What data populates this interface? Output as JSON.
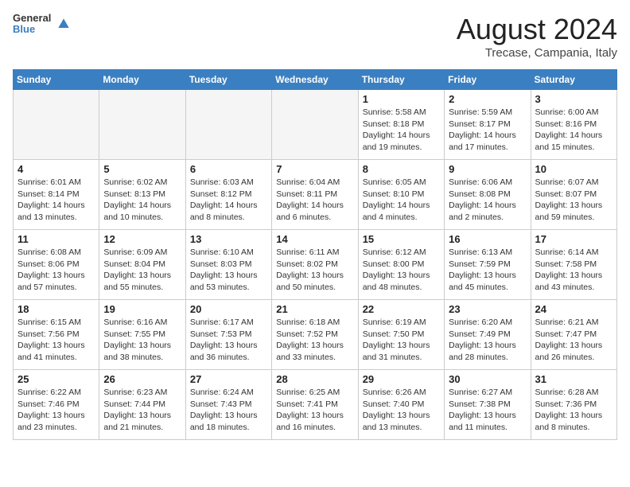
{
  "header": {
    "logo_line1": "General",
    "logo_line2": "Blue",
    "month_title": "August 2024",
    "location": "Trecase, Campania, Italy"
  },
  "days_of_week": [
    "Sunday",
    "Monday",
    "Tuesday",
    "Wednesday",
    "Thursday",
    "Friday",
    "Saturday"
  ],
  "weeks": [
    [
      {
        "day": "",
        "info": ""
      },
      {
        "day": "",
        "info": ""
      },
      {
        "day": "",
        "info": ""
      },
      {
        "day": "",
        "info": ""
      },
      {
        "day": "1",
        "info": "Sunrise: 5:58 AM\nSunset: 8:18 PM\nDaylight: 14 hours\nand 19 minutes."
      },
      {
        "day": "2",
        "info": "Sunrise: 5:59 AM\nSunset: 8:17 PM\nDaylight: 14 hours\nand 17 minutes."
      },
      {
        "day": "3",
        "info": "Sunrise: 6:00 AM\nSunset: 8:16 PM\nDaylight: 14 hours\nand 15 minutes."
      }
    ],
    [
      {
        "day": "4",
        "info": "Sunrise: 6:01 AM\nSunset: 8:14 PM\nDaylight: 14 hours\nand 13 minutes."
      },
      {
        "day": "5",
        "info": "Sunrise: 6:02 AM\nSunset: 8:13 PM\nDaylight: 14 hours\nand 10 minutes."
      },
      {
        "day": "6",
        "info": "Sunrise: 6:03 AM\nSunset: 8:12 PM\nDaylight: 14 hours\nand 8 minutes."
      },
      {
        "day": "7",
        "info": "Sunrise: 6:04 AM\nSunset: 8:11 PM\nDaylight: 14 hours\nand 6 minutes."
      },
      {
        "day": "8",
        "info": "Sunrise: 6:05 AM\nSunset: 8:10 PM\nDaylight: 14 hours\nand 4 minutes."
      },
      {
        "day": "9",
        "info": "Sunrise: 6:06 AM\nSunset: 8:08 PM\nDaylight: 14 hours\nand 2 minutes."
      },
      {
        "day": "10",
        "info": "Sunrise: 6:07 AM\nSunset: 8:07 PM\nDaylight: 13 hours\nand 59 minutes."
      }
    ],
    [
      {
        "day": "11",
        "info": "Sunrise: 6:08 AM\nSunset: 8:06 PM\nDaylight: 13 hours\nand 57 minutes."
      },
      {
        "day": "12",
        "info": "Sunrise: 6:09 AM\nSunset: 8:04 PM\nDaylight: 13 hours\nand 55 minutes."
      },
      {
        "day": "13",
        "info": "Sunrise: 6:10 AM\nSunset: 8:03 PM\nDaylight: 13 hours\nand 53 minutes."
      },
      {
        "day": "14",
        "info": "Sunrise: 6:11 AM\nSunset: 8:02 PM\nDaylight: 13 hours\nand 50 minutes."
      },
      {
        "day": "15",
        "info": "Sunrise: 6:12 AM\nSunset: 8:00 PM\nDaylight: 13 hours\nand 48 minutes."
      },
      {
        "day": "16",
        "info": "Sunrise: 6:13 AM\nSunset: 7:59 PM\nDaylight: 13 hours\nand 45 minutes."
      },
      {
        "day": "17",
        "info": "Sunrise: 6:14 AM\nSunset: 7:58 PM\nDaylight: 13 hours\nand 43 minutes."
      }
    ],
    [
      {
        "day": "18",
        "info": "Sunrise: 6:15 AM\nSunset: 7:56 PM\nDaylight: 13 hours\nand 41 minutes."
      },
      {
        "day": "19",
        "info": "Sunrise: 6:16 AM\nSunset: 7:55 PM\nDaylight: 13 hours\nand 38 minutes."
      },
      {
        "day": "20",
        "info": "Sunrise: 6:17 AM\nSunset: 7:53 PM\nDaylight: 13 hours\nand 36 minutes."
      },
      {
        "day": "21",
        "info": "Sunrise: 6:18 AM\nSunset: 7:52 PM\nDaylight: 13 hours\nand 33 minutes."
      },
      {
        "day": "22",
        "info": "Sunrise: 6:19 AM\nSunset: 7:50 PM\nDaylight: 13 hours\nand 31 minutes."
      },
      {
        "day": "23",
        "info": "Sunrise: 6:20 AM\nSunset: 7:49 PM\nDaylight: 13 hours\nand 28 minutes."
      },
      {
        "day": "24",
        "info": "Sunrise: 6:21 AM\nSunset: 7:47 PM\nDaylight: 13 hours\nand 26 minutes."
      }
    ],
    [
      {
        "day": "25",
        "info": "Sunrise: 6:22 AM\nSunset: 7:46 PM\nDaylight: 13 hours\nand 23 minutes."
      },
      {
        "day": "26",
        "info": "Sunrise: 6:23 AM\nSunset: 7:44 PM\nDaylight: 13 hours\nand 21 minutes."
      },
      {
        "day": "27",
        "info": "Sunrise: 6:24 AM\nSunset: 7:43 PM\nDaylight: 13 hours\nand 18 minutes."
      },
      {
        "day": "28",
        "info": "Sunrise: 6:25 AM\nSunset: 7:41 PM\nDaylight: 13 hours\nand 16 minutes."
      },
      {
        "day": "29",
        "info": "Sunrise: 6:26 AM\nSunset: 7:40 PM\nDaylight: 13 hours\nand 13 minutes."
      },
      {
        "day": "30",
        "info": "Sunrise: 6:27 AM\nSunset: 7:38 PM\nDaylight: 13 hours\nand 11 minutes."
      },
      {
        "day": "31",
        "info": "Sunrise: 6:28 AM\nSunset: 7:36 PM\nDaylight: 13 hours\nand 8 minutes."
      }
    ]
  ]
}
